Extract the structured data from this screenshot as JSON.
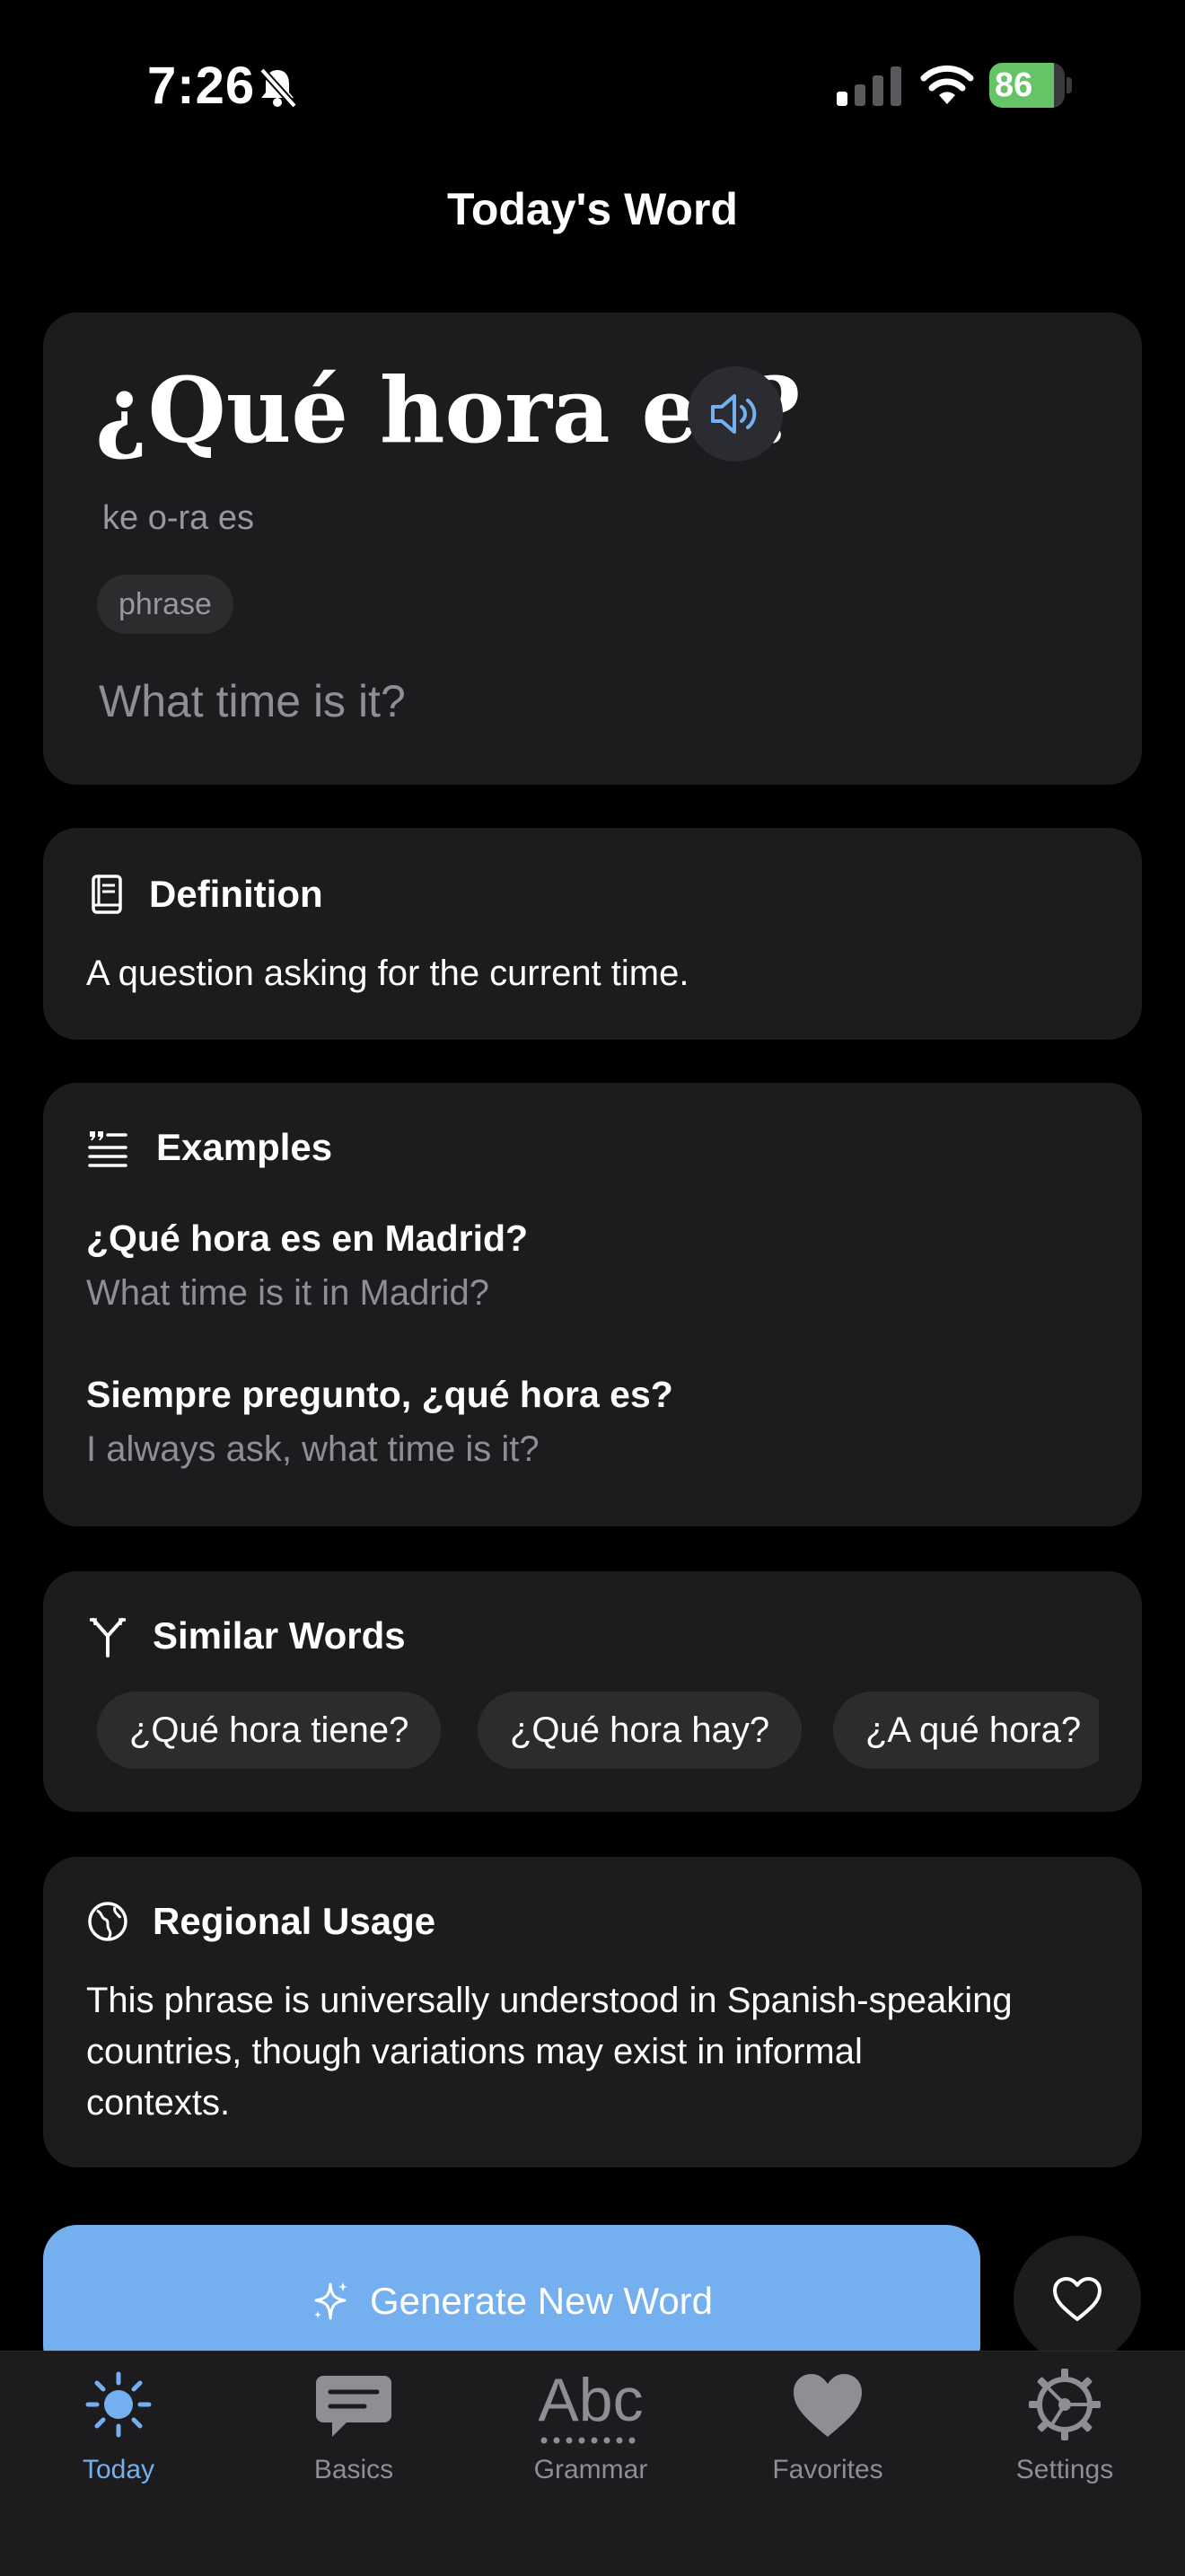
{
  "status_bar": {
    "time": "7:26",
    "battery": "86",
    "battery_level": 0.86
  },
  "header": {
    "title": "Today's Word"
  },
  "word_card": {
    "word": "¿Qué hora es?",
    "pronunciation": "ke o-ra es",
    "part_of_speech": "phrase",
    "translation": "What time is it?"
  },
  "definition": {
    "title": "Definition",
    "text": "A question asking for the current time."
  },
  "examples": {
    "title": "Examples",
    "items": [
      {
        "es": "¿Qué hora es en Madrid?",
        "en": "What time is it in Madrid?"
      },
      {
        "es": "Siempre pregunto, ¿qué hora es?",
        "en": "I always ask, what time is it?"
      }
    ]
  },
  "similar": {
    "title": "Similar Words",
    "items": [
      "¿Qué hora tiene?",
      "¿Qué hora hay?",
      "¿A qué hora?"
    ]
  },
  "regional": {
    "title": "Regional Usage",
    "lines": [
      "This phrase is universally understood in Spanish-speaking",
      "countries, though variations may exist in informal",
      "contexts."
    ]
  },
  "actions": {
    "generate_label": "Generate New Word"
  },
  "tabs": [
    {
      "label": "Today",
      "icon": "sun-icon",
      "active": true
    },
    {
      "label": "Basics",
      "icon": "chat-bubble-icon",
      "active": false
    },
    {
      "label": "Grammar",
      "icon": "abc-icon",
      "active": false
    },
    {
      "label": "Favorites",
      "icon": "heart-icon",
      "active": false
    },
    {
      "label": "Settings",
      "icon": "gear-icon",
      "active": false
    }
  ],
  "colors": {
    "background": "#000000",
    "card": "#1c1c1e",
    "chip": "#2c2c2e",
    "accent": "#74aff0",
    "muted_text": "#8e8e93",
    "battery": "#65c466"
  }
}
